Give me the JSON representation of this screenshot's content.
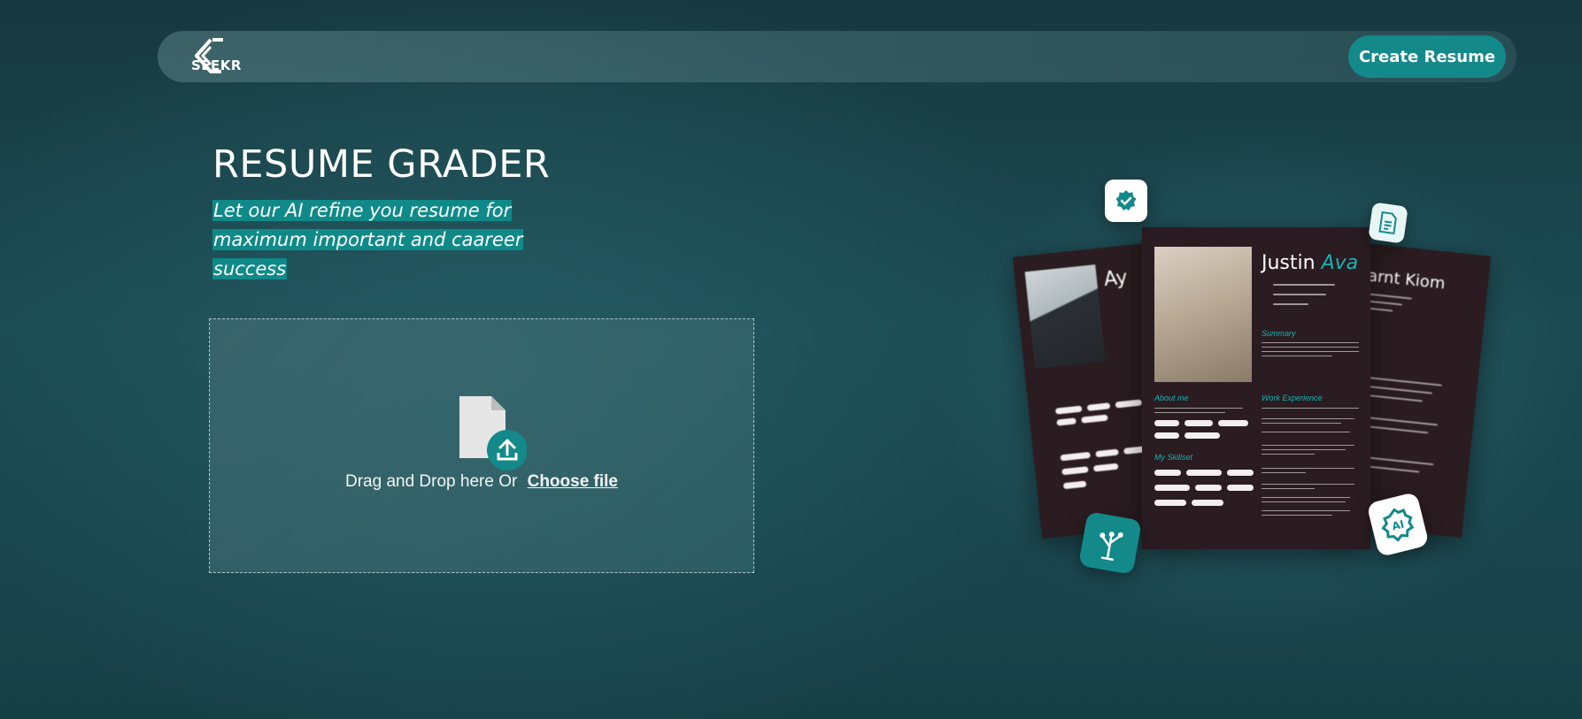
{
  "navbar": {
    "logo_text": "SEEKR",
    "create_button_label": "Create Resume"
  },
  "hero": {
    "title": "RESUME GRADER",
    "subtitle": "Let our AI refine you resume for maximum important and caareer success"
  },
  "dropzone": {
    "drag_text": "Drag and Drop here Or",
    "choose_file_label": "Choose file"
  },
  "illustration": {
    "center_card": {
      "first_name": "Justin",
      "last_name": "Ava",
      "sections": [
        "Summary",
        "About me",
        "Work Experience",
        "My Skillset"
      ]
    },
    "left_card_name": "Ay",
    "right_card_name": "Garnt Kiom"
  },
  "colors": {
    "accent": "#13898a",
    "highlight": "#0f8a89",
    "background": "#1b4a52"
  }
}
